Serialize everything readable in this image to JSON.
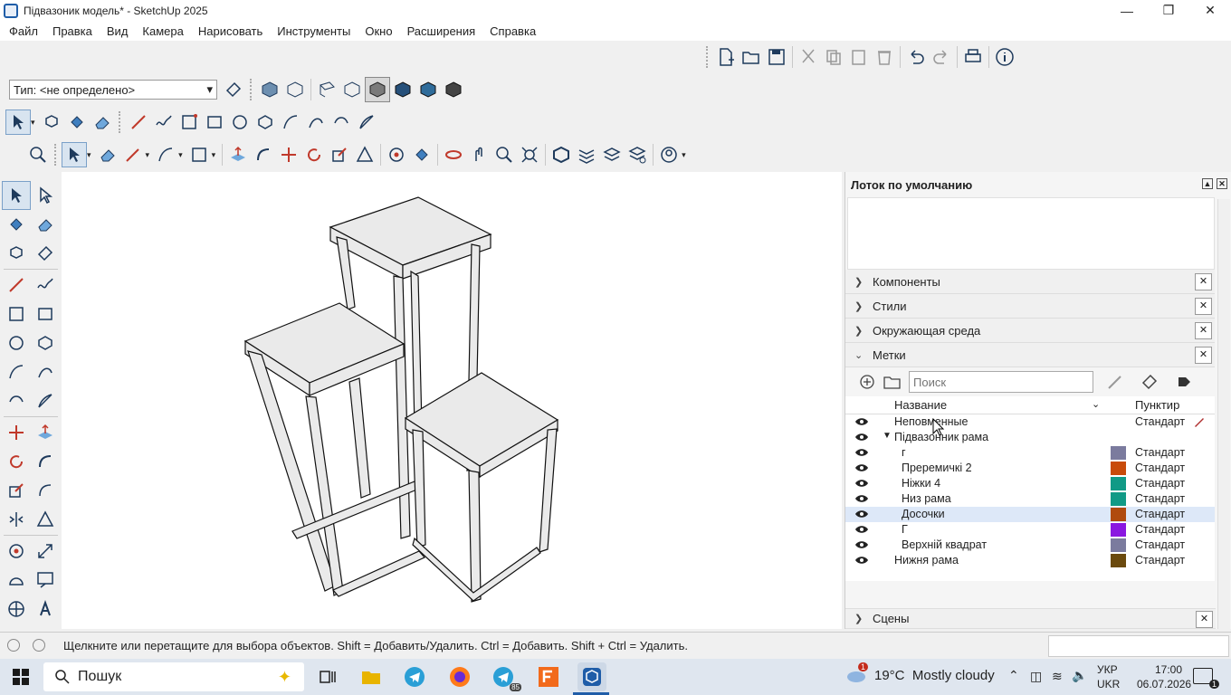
{
  "window": {
    "title": "Підвазоник модель* - SketchUp 2025"
  },
  "menu": [
    "Файл",
    "Правка",
    "Вид",
    "Камера",
    "Нарисовать",
    "Инструменты",
    "Окно",
    "Расширения",
    "Справка"
  ],
  "tag_selector": {
    "value": "Тип: <не определено>"
  },
  "tray": {
    "title": "Лоток по умолчанию",
    "sections": [
      {
        "label": "Компоненты",
        "expanded": false
      },
      {
        "label": "Стили",
        "expanded": false
      },
      {
        "label": "Окружающая среда",
        "expanded": false
      },
      {
        "label": "Метки",
        "expanded": true
      }
    ],
    "bottom_section": {
      "label": "Сцены"
    },
    "tags": {
      "search_placeholder": "Поиск",
      "col_name": "Название",
      "col_dash": "Пунктир",
      "rows": [
        {
          "name": "Неповменные",
          "dash": "Стандарт",
          "color": "",
          "indent": 0
        },
        {
          "name": "Підвазонник рама",
          "dash": "",
          "color": "",
          "indent": 0,
          "folder": true
        },
        {
          "name": "г",
          "dash": "Стандарт",
          "color": "#7b7b9e",
          "indent": 1
        },
        {
          "name": "Преремичкі 2",
          "dash": "Стандарт",
          "color": "#c84b0a",
          "indent": 1
        },
        {
          "name": "Ніжки 4",
          "dash": "Стандарт",
          "color": "#119a86",
          "indent": 1
        },
        {
          "name": "Низ рама",
          "dash": "Стандарт",
          "color": "#119a86",
          "indent": 1
        },
        {
          "name": "Досочки",
          "dash": "Стандарт",
          "color": "#b04a0e",
          "indent": 1,
          "selected": true
        },
        {
          "name": "Г",
          "dash": "Стандарт",
          "color": "#8a17e0",
          "indent": 1
        },
        {
          "name": "Верхній квадрат",
          "dash": "Стандарт",
          "color": "#7b7b9e",
          "indent": 1
        },
        {
          "name": "Нижня рама",
          "dash": "Стандарт",
          "color": "#6b4a0e",
          "indent": 0
        }
      ]
    }
  },
  "status": {
    "text": "Щелкните или перетащите для выбора объектов. Shift = Добавить/Удалить. Ctrl = Добавить. Shift + Ctrl = Удалить."
  },
  "taskbar": {
    "search": "Пошук",
    "weather": "19°C  Mostly cloudy",
    "weather_badge": "1",
    "lang_top": "УКР",
    "lang_bottom": "UKR",
    "time": "17:00",
    "date": "06.07.2026",
    "notif": "1",
    "telegram_badge": "85"
  }
}
